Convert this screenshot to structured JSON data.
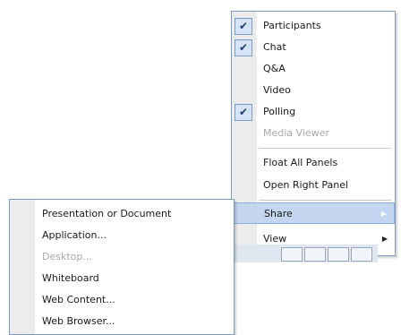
{
  "right_menu": {
    "items": [
      {
        "label": "Participants",
        "checked": true,
        "disabled": false
      },
      {
        "label": "Chat",
        "checked": true,
        "disabled": false
      },
      {
        "label": "Q&A",
        "checked": false,
        "disabled": false
      },
      {
        "label": "Video",
        "checked": false,
        "disabled": false
      },
      {
        "label": "Polling",
        "checked": true,
        "disabled": false
      },
      {
        "label": "Media Viewer",
        "checked": false,
        "disabled": true
      }
    ],
    "float_all": "Float All Panels",
    "open_right": "Open Right Panel",
    "share": "Share",
    "view": "View"
  },
  "share_submenu": {
    "items": [
      {
        "label": "Presentation or Document",
        "disabled": false
      },
      {
        "label": "Application...",
        "disabled": false
      },
      {
        "label": "Desktop...",
        "disabled": true
      },
      {
        "label": "Whiteboard",
        "disabled": false
      },
      {
        "label": "Web Content...",
        "disabled": false
      },
      {
        "label": "Web Browser...",
        "disabled": false
      }
    ]
  },
  "icons": {
    "check": "checkmark-icon",
    "submenu_arrow": "submenu-arrow-icon"
  },
  "colors": {
    "menu_border": "#7a9cc4",
    "highlight_bg": "#c3d5ef",
    "check_bg": "#d6e3f4",
    "gutter": "#ececec",
    "disabled_text": "#a8a8a8"
  }
}
